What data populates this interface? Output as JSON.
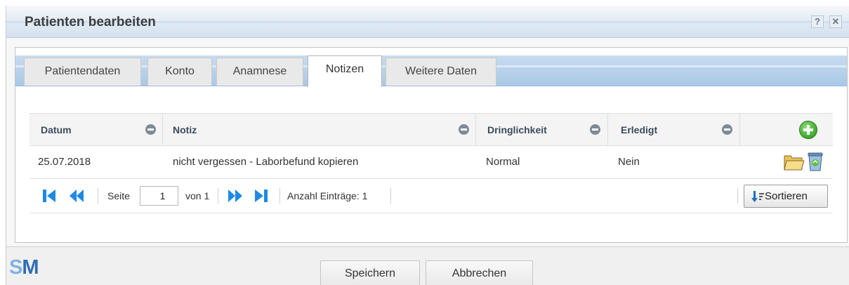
{
  "dialog": {
    "title": "Patienten bearbeiten",
    "help_label": "?",
    "close_label": "✕"
  },
  "tabs": [
    {
      "label": "Patientendaten",
      "active": false
    },
    {
      "label": "Konto",
      "active": false
    },
    {
      "label": "Anamnese",
      "active": false
    },
    {
      "label": "Notizen",
      "active": true
    },
    {
      "label": "Weitere Daten",
      "active": false
    }
  ],
  "grid": {
    "columns": [
      "Datum",
      "Notiz",
      "Dringlichkeit",
      "Erledigt"
    ],
    "rows": [
      {
        "datum": "25.07.2018",
        "notiz": "nicht vergessen - Laborbefund kopieren",
        "dringlichkeit": "Normal",
        "erledigt": "Nein"
      }
    ],
    "icons": {
      "add": "add-icon",
      "edit": "folder-icon",
      "delete": "recycle-bin-icon",
      "sort_header": "collapse-minus-icon"
    }
  },
  "pager": {
    "page_label": "Seite",
    "page_value": "1",
    "of_label": "von 1",
    "count_label": "Anzahl Einträge: 1",
    "sort_label": "Sortieren"
  },
  "footer": {
    "logo_s": "S",
    "logo_m": "M",
    "save_label": "Speichern",
    "cancel_label": "Abbrechen"
  },
  "colors": {
    "accent_blue": "#1e8ae6",
    "title_bar": "#d3e1ef",
    "tab_bar": "#a9c8e6",
    "add_green": "#4cb33a"
  }
}
